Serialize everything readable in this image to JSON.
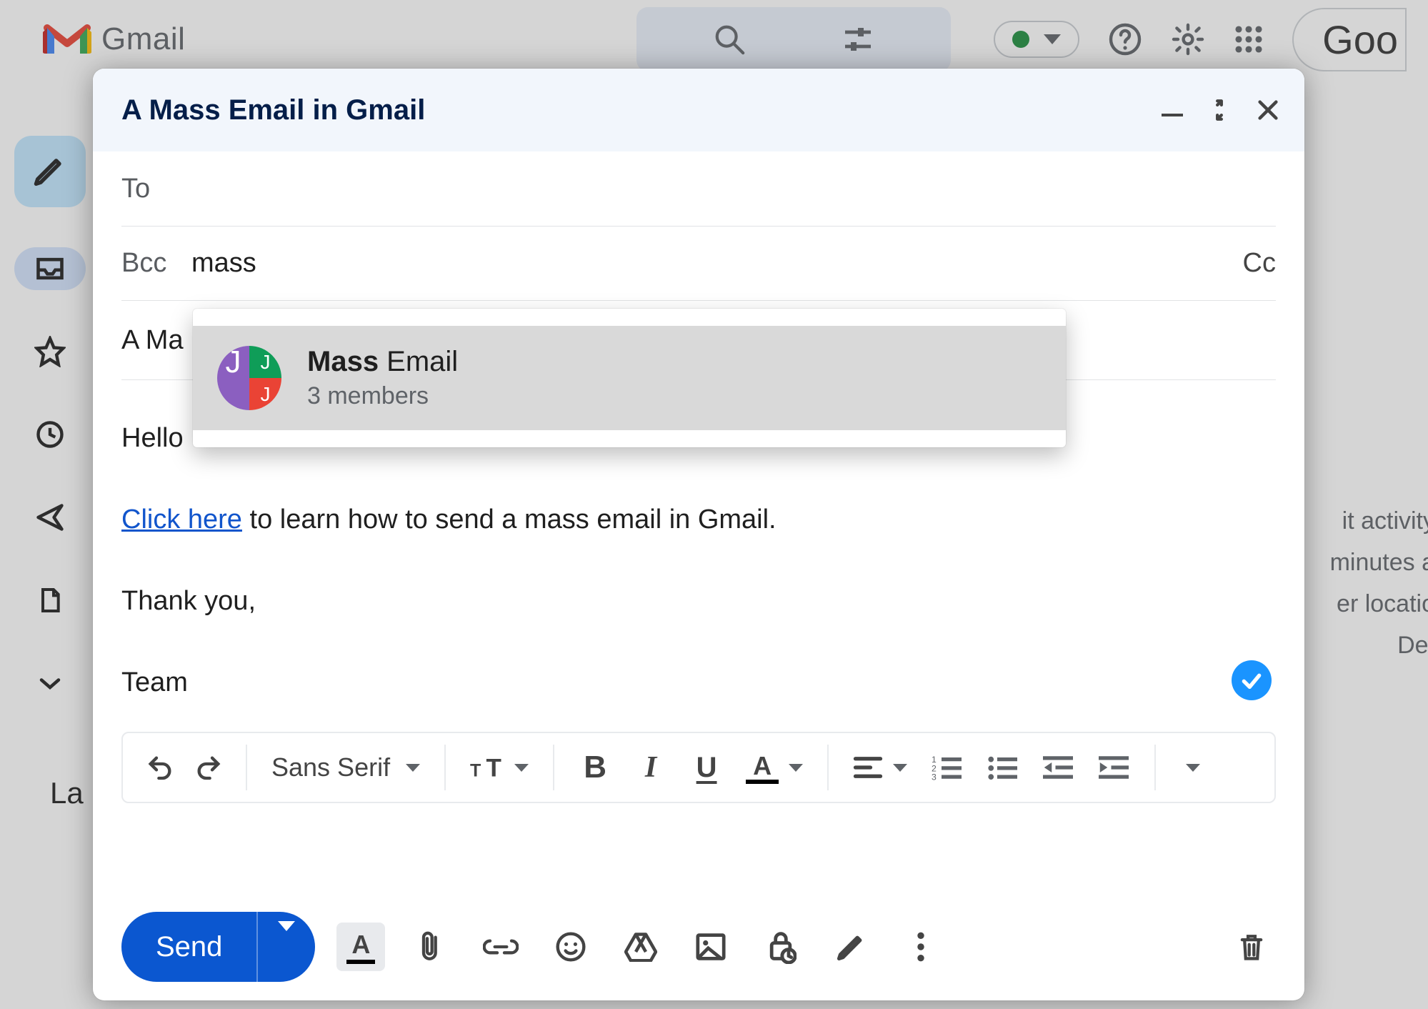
{
  "header": {
    "app_name": "Gmail",
    "right_word": "Goo"
  },
  "sidebar": {
    "label_heading": "La"
  },
  "right_fragments": {
    "l1": "it activity",
    "l2": "minutes a",
    "l3": "er locatio",
    "l4": "Det"
  },
  "compose": {
    "title": "A Mass Email in Gmail",
    "to_label": "To",
    "bcc_label": "Bcc",
    "bcc_value": "mass",
    "cc_label": "Cc",
    "subject_fragment": "A Ma",
    "body": {
      "hello": "Hello",
      "link_text": "Click here",
      "after_link": " to learn how to send a mass email in Gmail.",
      "thank_you": "Thank you,",
      "team": "Team"
    },
    "font_family": "Sans Serif",
    "send_label": "Send"
  },
  "autocomplete": {
    "bold_part": "Mass",
    "rest_part": " Email",
    "sub": "3 members",
    "avatar_letter": "J"
  }
}
